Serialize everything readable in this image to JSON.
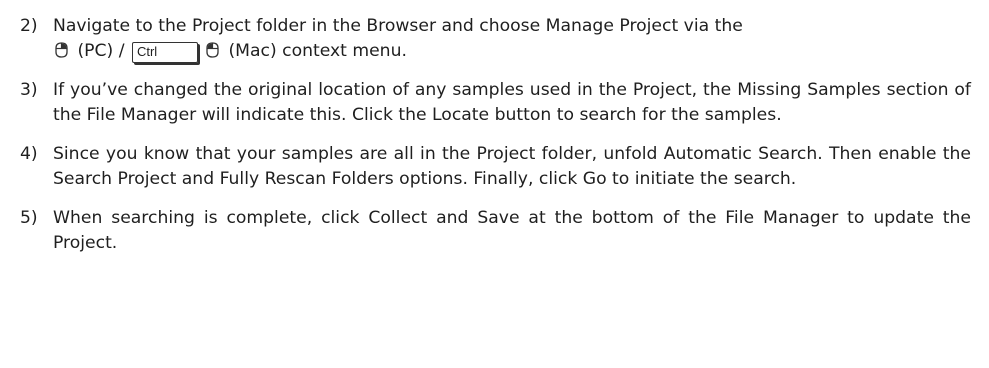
{
  "steps": [
    {
      "number": "2)",
      "line1": "Navigate to the Project folder in the Browser and choose Manage Project via the",
      "pc_label": "(PC) /",
      "ctrl_key": "Ctrl",
      "mac_label": "(Mac) context menu.",
      "icons": [
        "right-click-mouse-icon",
        "right-click-mouse-icon"
      ]
    },
    {
      "number": "3)",
      "text": "If you’ve changed the original location of any samples used in the Project, the Missing Samples section of the File Manager will indicate this.  Click the Locate button to search for the samples."
    },
    {
      "number": "4)",
      "text": "Since you know that your samples are all in the Project folder, unfold Automatic Search.  Then enable the Search Project and Fully Rescan Folders options.  Finally, click Go to initiate the search."
    },
    {
      "number": "5)",
      "text": "When searching is complete, click Collect and Save at the bottom of the File Manager to update the Project."
    }
  ]
}
